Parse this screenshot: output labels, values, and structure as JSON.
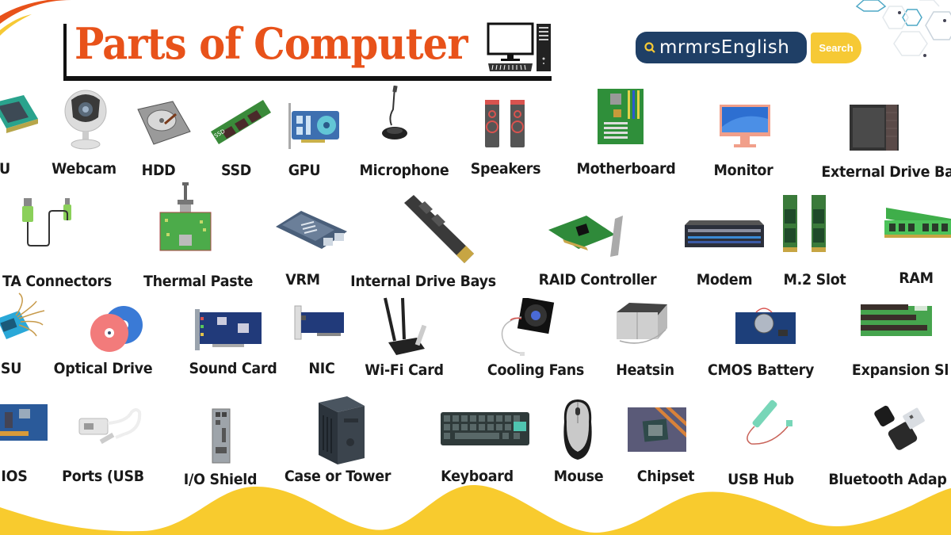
{
  "header": {
    "title": "Parts of Computer",
    "title_icon": "desktop-computer-icon",
    "brand_search_text": "mrmrsEnglish",
    "search_button_label": "Search",
    "colors": {
      "title": "#e8521a",
      "search_box": "#1f3f66",
      "search_button": "#f6c935",
      "wave": "#f8cb2e"
    }
  },
  "rows": [
    {
      "items": [
        {
          "label": "U",
          "icon": "cpu-chip-icon"
        },
        {
          "label": "Webcam",
          "icon": "webcam-icon"
        },
        {
          "label": "HDD",
          "icon": "hard-disk-icon"
        },
        {
          "label": "SSD",
          "icon": "ssd-icon"
        },
        {
          "label": "GPU",
          "icon": "graphics-card-icon"
        },
        {
          "label": "Microphone",
          "icon": "microphone-icon"
        },
        {
          "label": "Speakers",
          "icon": "speakers-icon"
        },
        {
          "label": "Motherboard",
          "icon": "motherboard-icon"
        },
        {
          "label": "Monitor",
          "icon": "monitor-icon"
        },
        {
          "label": "External Drive Ba",
          "icon": "external-drive-bay-icon"
        }
      ]
    },
    {
      "items": [
        {
          "label": "TA Connectors",
          "icon": "sata-cable-icon"
        },
        {
          "label": "Thermal Paste",
          "icon": "thermal-paste-icon"
        },
        {
          "label": "VRM",
          "icon": "vrm-icon"
        },
        {
          "label": "Internal Drive Bays",
          "icon": "internal-drive-icon"
        },
        {
          "label": "RAID Controller",
          "icon": "raid-controller-icon"
        },
        {
          "label": "Modem",
          "icon": "modem-icon"
        },
        {
          "label": "M.2 Slot",
          "icon": "m2-slot-icon"
        },
        {
          "label": "RAM",
          "icon": "ram-icon"
        }
      ]
    },
    {
      "items": [
        {
          "label": "SU",
          "icon": "psu-icon"
        },
        {
          "label": "Optical Drive",
          "icon": "optical-disc-icon"
        },
        {
          "label": "Sound Card",
          "icon": "sound-card-icon"
        },
        {
          "label": "NIC",
          "icon": "network-card-icon"
        },
        {
          "label": "Wi-Fi Card",
          "icon": "wifi-card-icon"
        },
        {
          "label": "Cooling Fans",
          "icon": "cooling-fan-icon"
        },
        {
          "label": "Heatsin",
          "icon": "heatsink-icon"
        },
        {
          "label": "CMOS Battery",
          "icon": "cmos-battery-icon"
        },
        {
          "label": "Expansion Sl",
          "icon": "expansion-slot-icon"
        }
      ]
    },
    {
      "items": [
        {
          "label": "IOS",
          "icon": "bios-chip-icon"
        },
        {
          "label": "Ports (USB",
          "icon": "usb-adapter-icon"
        },
        {
          "label": "I/O Shield",
          "icon": "io-shield-icon"
        },
        {
          "label": "Case or Tower",
          "icon": "computer-tower-icon"
        },
        {
          "label": "Keyboard",
          "icon": "keyboard-icon"
        },
        {
          "label": "Mouse",
          "icon": "mouse-icon"
        },
        {
          "label": "Chipset",
          "icon": "chipset-icon"
        },
        {
          "label": "USB Hub",
          "icon": "usb-hub-icon"
        },
        {
          "label": "Bluetooth Adap",
          "icon": "bluetooth-adapter-icon"
        }
      ]
    }
  ]
}
